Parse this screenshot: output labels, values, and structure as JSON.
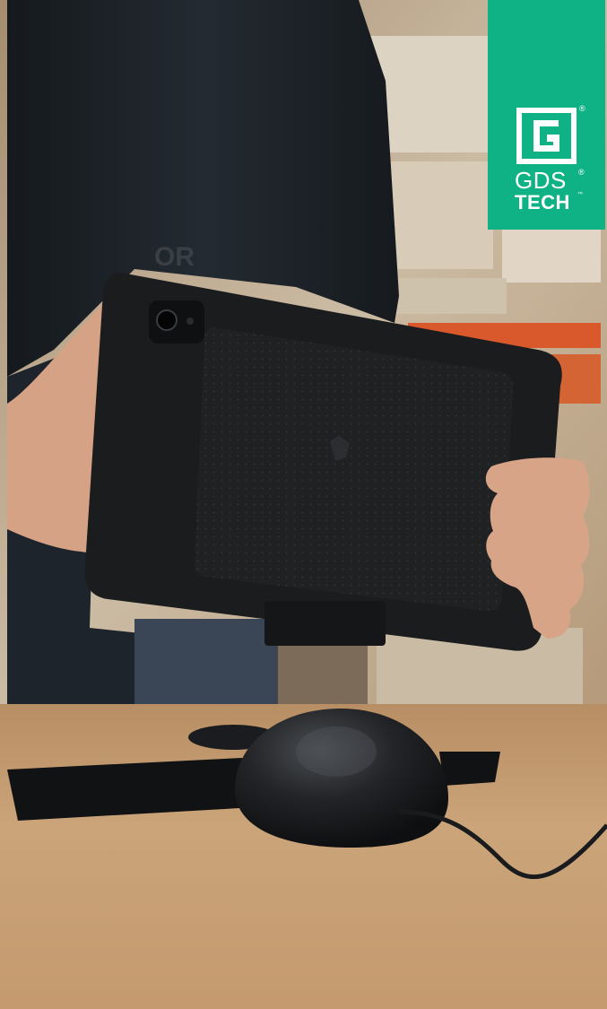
{
  "logo": {
    "line1": "GDS",
    "line2": "TECH",
    "registered_symbol": "®",
    "trademark_symbol": "™",
    "badge_color": "#0fb284"
  },
  "photo": {
    "colors": {
      "wall": "#c9b9a0",
      "jacket": "#1c2126",
      "tablet": "#1a1b1d",
      "desk": "#c79f74",
      "skin": "#d9a88c"
    }
  }
}
